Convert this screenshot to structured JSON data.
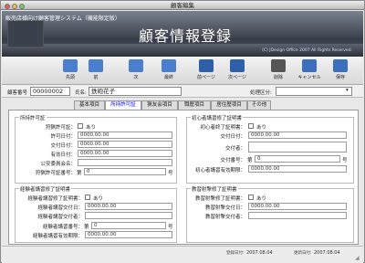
{
  "window": {
    "title": "顧客編集"
  },
  "banner": {
    "subtitle": "販売店様向け顧客管理システム（機能限定版）",
    "title": "顧客情報登録",
    "copyright": "(C) JDesign Office 2007 All Rights Reserved."
  },
  "toolbar": {
    "items": [
      {
        "label": "先頭",
        "icon": "first-record-icon",
        "color": "#4a7fd0"
      },
      {
        "label": "前",
        "icon": "previous-record-icon",
        "color": "#4a7fd0"
      },
      {
        "label": "次",
        "icon": "next-record-icon",
        "color": "#4a7fd0"
      },
      {
        "label": "最終",
        "icon": "last-record-icon",
        "color": "#4a7fd0"
      },
      {
        "label": "前ページ",
        "icon": "previous-page-icon",
        "color": "#2f5fa8"
      },
      {
        "label": "次ページ",
        "icon": "next-page-icon",
        "color": "#2f5fa8"
      },
      {
        "label": "削除",
        "icon": "delete-icon",
        "color": "#555555"
      },
      {
        "label": "キャンセル",
        "icon": "cancel-icon",
        "color": "#3d6fbf"
      },
      {
        "label": "保存",
        "icon": "save-icon",
        "color": "#3d6fbf"
      }
    ]
  },
  "header": {
    "customer_no_label": "顧客番号",
    "customer_no": "00000002",
    "name_label": "氏名:",
    "name": "鉄砲花子",
    "category_label": "処理区分:",
    "category": ""
  },
  "tabs": [
    {
      "label": "基本項目",
      "active": false
    },
    {
      "label": "所持許可証",
      "active": true
    },
    {
      "label": "猟友会項目",
      "active": false
    },
    {
      "label": "職歴項目",
      "active": false
    },
    {
      "label": "居住歴項目",
      "active": false
    },
    {
      "label": "その他",
      "active": false
    }
  ],
  "sections": {
    "license": {
      "title": "所持許可証",
      "permit_label": "狩猟許可証：",
      "permit_check": "あり",
      "issue_label": "許可日付：",
      "issue_date": "0000.00.00",
      "delivery_label": "交付日付：",
      "delivery_date": "0000.00.00",
      "expiry_label": "有効日付：",
      "expiry_date": "0000.00.00",
      "commission_label": "公安委員会名：",
      "commission": "",
      "number_label": "狩猟許可証番号：",
      "number_prefix": "第",
      "number": "0",
      "number_suffix": "号"
    },
    "beginner": {
      "title": "初心者講習修了証明書",
      "cert_label": "初心者終了証明書：",
      "cert_check": "あり",
      "delivery_label": "交付日付：",
      "delivery_date": "0000.00.00",
      "office_label": "交付者：",
      "office": "",
      "number_label": "交付番号：",
      "number_prefix": "第",
      "number": "0",
      "number_suffix": "号",
      "expiry_label": "初心者講習有効期限：",
      "expiry_date": "0000.00.00"
    },
    "experienced": {
      "title": "経験者講習修了証明書",
      "cert_label": "経験者講習修了証明書：",
      "cert_check": "あり",
      "delivery_label": "経験者講習交付日：",
      "delivery_date": "0000.00.00",
      "office_label": "経験者講習交付者：",
      "office": "",
      "number_label": "経験者講習番号：",
      "number_prefix": "第",
      "number": "0",
      "number_suffix": "号",
      "expiry_label": "経験者講習有効期限：",
      "expiry_date": "0000.00.00"
    },
    "shooting": {
      "title": "教習射撃修了証明書",
      "cert_label": "教習射撃修了証明書：",
      "cert_check": "あり",
      "delivery_label": "教習射撃交付日：",
      "delivery_date": "0000.00.00",
      "office_label": "教習射撃交付者：",
      "office": ""
    }
  },
  "footer": {
    "created_label": "登録日付:",
    "created": "2007.08.04",
    "updated_label": "更新日付:",
    "updated": "2007.08.04"
  }
}
